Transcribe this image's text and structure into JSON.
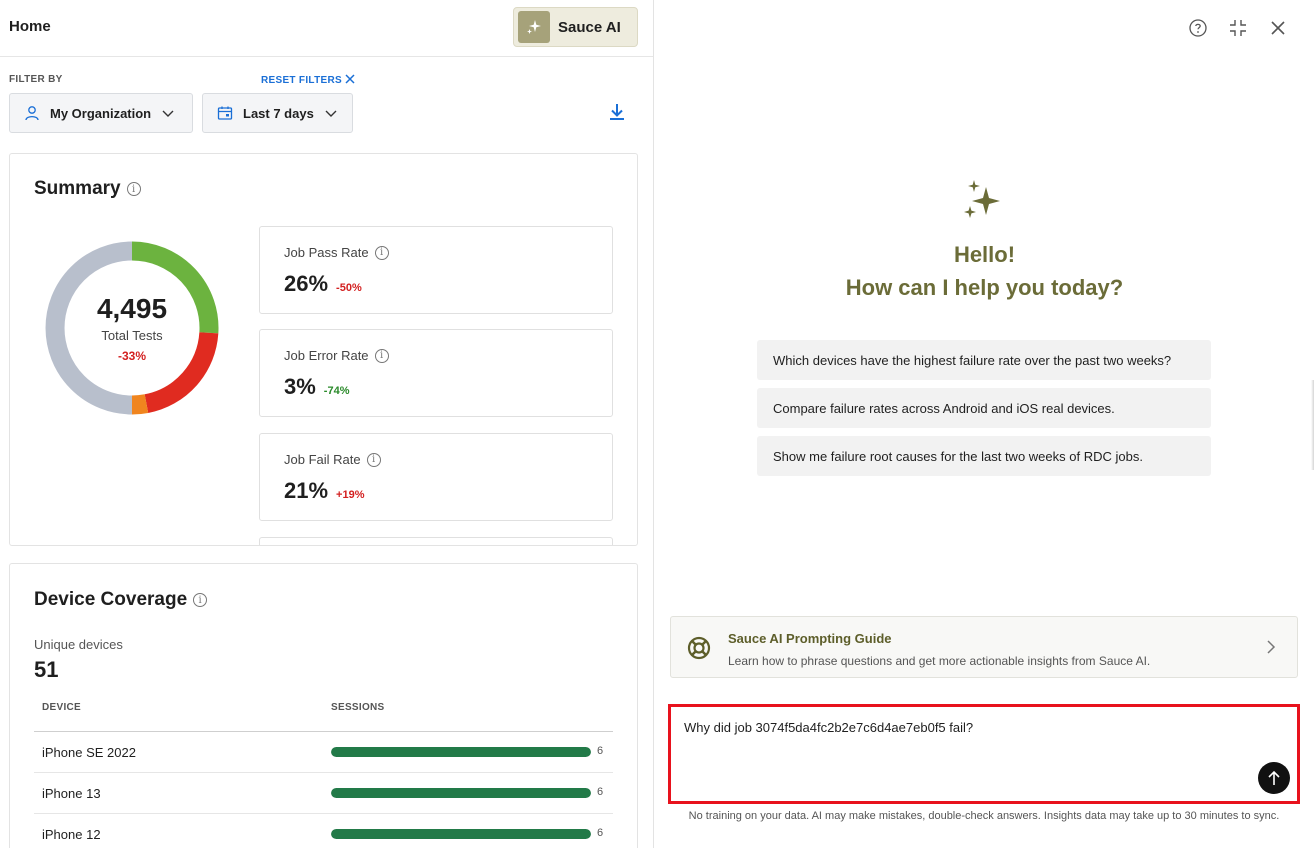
{
  "header": {
    "title": "Home",
    "sauce_ai_label": "Sauce AI"
  },
  "filters": {
    "filter_by_label": "FILTER BY",
    "reset_label": "RESET FILTERS",
    "organization": "My Organization",
    "date_range": "Last 7 days"
  },
  "summary": {
    "title": "Summary",
    "total_tests": "4,495",
    "total_label": "Total Tests",
    "total_delta": "-33%",
    "donut_fractions": {
      "pass": 0.26,
      "fail": 0.21,
      "error": 0.03,
      "other": 0.5
    },
    "metrics": [
      {
        "label": "Job Pass Rate",
        "value": "26%",
        "delta": "-50%"
      },
      {
        "label": "Job Error Rate",
        "value": "3%",
        "delta": "-74%"
      },
      {
        "label": "Job Fail Rate",
        "value": "21%",
        "delta": "+19%"
      }
    ]
  },
  "device_coverage": {
    "title": "Device Coverage",
    "unique_label": "Unique devices",
    "unique_value": "51",
    "col_device": "DEVICE",
    "col_sessions": "SESSIONS",
    "rows": [
      {
        "device": "iPhone SE 2022",
        "sessions": "6",
        "fill": 1.0
      },
      {
        "device": "iPhone 13",
        "sessions": "6",
        "fill": 1.0
      },
      {
        "device": "iPhone 12",
        "sessions": "6",
        "fill": 1.0
      }
    ]
  },
  "assistant": {
    "greeting": "Hello!",
    "question": "How can I help you today?",
    "suggestions": [
      "Which devices have the highest failure rate over the past two weeks?",
      "Compare failure rates across Android and iOS real devices.",
      "Show me failure root causes for the last two weeks of RDC jobs."
    ],
    "guide_title": "Sauce AI Prompting Guide",
    "guide_subtitle": "Learn how to phrase questions and get more actionable insights from Sauce AI.",
    "prompt_text": "Why did job 3074f5da4fc2b2e7c6d4ae7eb0f5 fail?",
    "disclaimer": "No training on your data. AI may make mistakes, double-check answers. Insights data may take up to 30 minutes to sync."
  },
  "colors": {
    "pass": "#6cb33f",
    "fail": "#e02b20",
    "error": "#f0851f",
    "other": "#b8bfcc",
    "accent": "#6b6c38",
    "link": "#1a6fd6"
  }
}
